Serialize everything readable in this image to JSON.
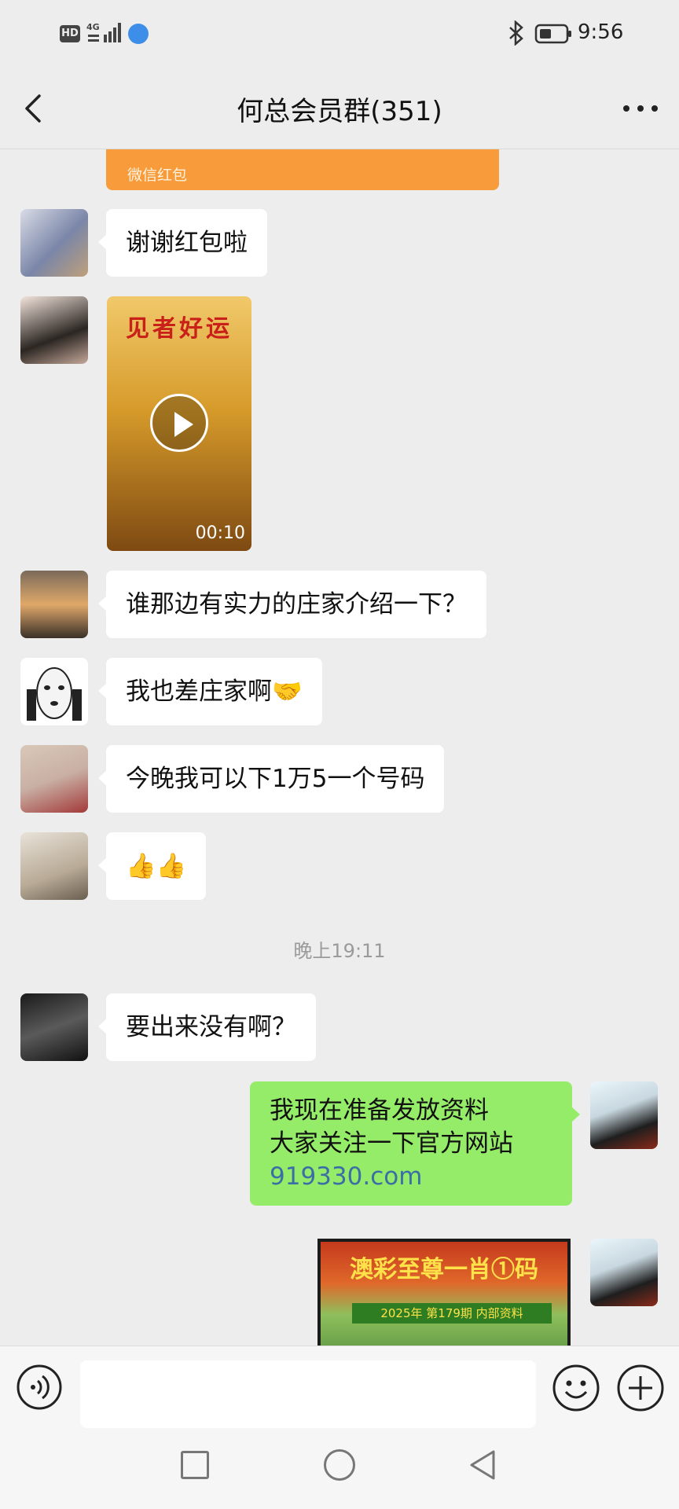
{
  "status_bar": {
    "hd_label": "HD",
    "network_label": "4G",
    "time": "9:56"
  },
  "header": {
    "title": "何总会员群(351)"
  },
  "messages": {
    "red_packet_label": "微信红包",
    "m1_text": "谢谢红包啦",
    "video_title": "见者好运",
    "video_duration": "00:10",
    "m3_text": "谁那边有实力的庄家介绍一下？",
    "m4_text": "我也差庄家啊🤝",
    "m5_text": "今晚我可以下1万5一个号码",
    "m6_text": "👍👍",
    "timestamp": "晚上19:11",
    "m7_text": "要出来没有啊？",
    "me_line1": "我现在准备发放资料",
    "me_line2": "大家关注一下官方网站",
    "me_link": "919330.com",
    "poster_title": "澳彩至尊一肖①码",
    "poster_subtitle": "2025年 第179期 内部资料"
  },
  "input": {
    "placeholder": ""
  },
  "colors": {
    "background": "#ededed",
    "bubble_other": "#ffffff",
    "bubble_self": "#95ec69",
    "red_packet": "#f79b3b"
  }
}
